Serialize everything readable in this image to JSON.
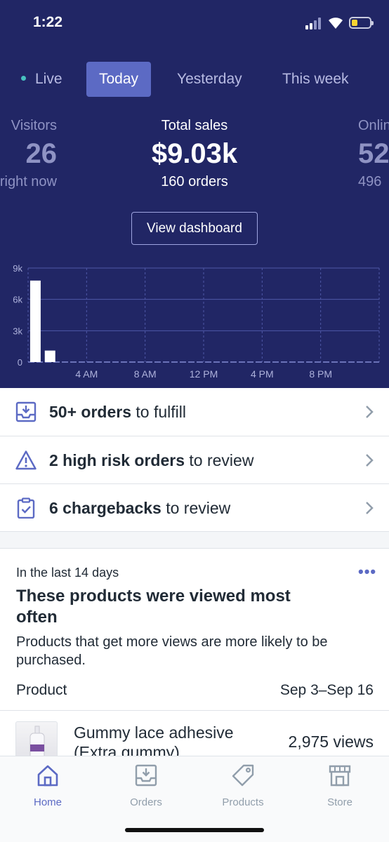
{
  "status_bar": {
    "time": "1:22"
  },
  "range_tabs": [
    {
      "label": "Live",
      "active": false
    },
    {
      "label": "Today",
      "active": true
    },
    {
      "label": "Yesterday",
      "active": false
    },
    {
      "label": "This week",
      "active": false
    }
  ],
  "stats": {
    "left": {
      "label": "Visitors",
      "value": "26",
      "sub": "right now"
    },
    "center": {
      "label": "Total sales",
      "value": "$9.03k",
      "sub": "160 orders"
    },
    "right": {
      "label": "Online store",
      "value": "52",
      "sub": "496"
    }
  },
  "dashboard_button": "View dashboard",
  "chart_data": {
    "type": "bar",
    "categories": [
      "12 AM",
      "1 AM",
      "2 AM",
      "3 AM",
      "4 AM",
      "5 AM",
      "6 AM",
      "7 AM",
      "8 AM",
      "9 AM",
      "10 AM",
      "11 AM",
      "12 PM",
      "1 PM",
      "2 PM",
      "3 PM",
      "4 PM",
      "5 PM",
      "6 PM",
      "7 PM",
      "8 PM",
      "9 PM",
      "10 PM",
      "11 PM"
    ],
    "values": [
      7800,
      1100,
      0,
      0,
      0,
      0,
      0,
      0,
      0,
      0,
      0,
      0,
      0,
      0,
      0,
      0,
      0,
      0,
      0,
      0,
      0,
      0,
      0,
      0
    ],
    "y_ticks": [
      "0",
      "3k",
      "6k",
      "9k"
    ],
    "ylim": [
      0,
      9000
    ],
    "x_tick_labels": [
      "4 AM",
      "8 AM",
      "12 PM",
      "4 PM",
      "8 PM"
    ],
    "grid": true
  },
  "tasks": [
    {
      "bold": "50+ orders",
      "rest": " to fulfill",
      "icon": "inbox-download-icon"
    },
    {
      "bold": "2 high risk orders",
      "rest": " to review",
      "icon": "warning-triangle-icon"
    },
    {
      "bold": "6 chargebacks",
      "rest": " to review",
      "icon": "clipboard-check-icon"
    }
  ],
  "insight_card": {
    "eyebrow": "In the last 14 days",
    "more": "•••",
    "title": "These products were viewed most often",
    "description": "Products that get more views are more likely to be purchased.",
    "column_product": "Product",
    "column_range": "Sep 3–Sep 16",
    "rows": [
      {
        "name": "Gummy lace adhesive (Extra gummy)",
        "views": "2,975 views"
      }
    ]
  },
  "tab_bar": [
    {
      "label": "Home",
      "icon": "home-icon",
      "active": true
    },
    {
      "label": "Orders",
      "icon": "orders-icon",
      "active": false
    },
    {
      "label": "Products",
      "icon": "tag-icon",
      "active": false
    },
    {
      "label": "Store",
      "icon": "store-icon",
      "active": false
    }
  ],
  "colors": {
    "header_bg": "#212665",
    "accent": "#5c6ac4",
    "live_dot": "#47c1bf"
  }
}
